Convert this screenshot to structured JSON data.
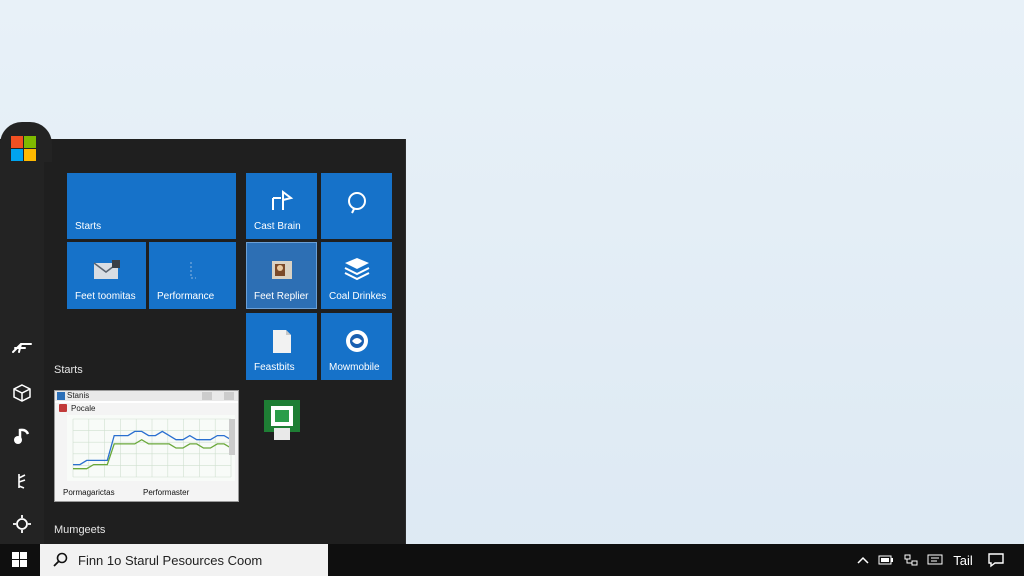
{
  "tiles": {
    "starts": "Starts",
    "cast_brain": "Cast Brain",
    "feet_toomitas": "Feet toomitas",
    "performance": "Performance",
    "feet_replier": "Feet Replier",
    "coal_drinkes": "Coal Drinkes",
    "feastbits": "Feastbits",
    "mowmobile": "Mowmobile"
  },
  "sections": {
    "starts": "Starts",
    "mumgeets": "Mumgeets"
  },
  "perf_window": {
    "title": "Stanis",
    "subtitle": "Pocale",
    "footer_left": "Pormagarictas",
    "footer_right": "Performaster"
  },
  "chart_data": {
    "type": "line",
    "series": [
      {
        "values": [
          3,
          3,
          4,
          4,
          4,
          4,
          10,
          10,
          10,
          11,
          11,
          10,
          10,
          11,
          10,
          9,
          9,
          10,
          9,
          9,
          9,
          10,
          10,
          9
        ]
      },
      {
        "values": [
          2,
          2,
          2,
          3,
          3,
          3,
          8,
          8,
          8,
          8,
          9,
          8,
          8,
          8,
          8,
          7,
          7,
          8,
          8,
          7,
          7,
          8,
          8,
          7
        ]
      }
    ],
    "ylim": [
      0,
      14
    ]
  },
  "taskbar": {
    "search_text": "Finn 1o Starul Pesources Coom",
    "clock": "Tail"
  },
  "colors": {
    "tile_blue": "#1672c9",
    "menu_bg": "#1f1f1f",
    "taskbar_bg": "#0f0f0f"
  }
}
